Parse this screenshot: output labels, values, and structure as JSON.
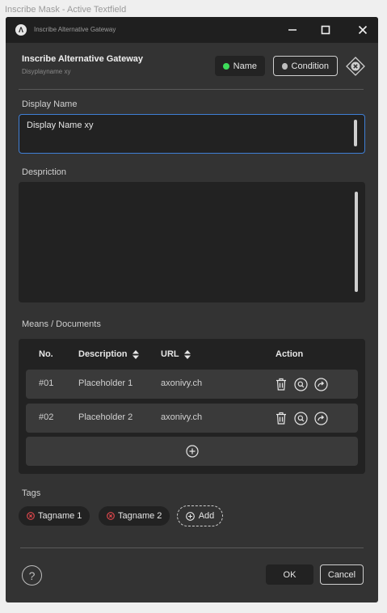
{
  "caption": "Inscribe Mask - Active Textfield",
  "window": {
    "title": "Inscribe Alternative Gateway",
    "logo_letter": "Λ"
  },
  "header": {
    "title": "Inscribe Alternative Gateway",
    "subtitle": "Disyplayname xy",
    "name_pill": "Name",
    "condition_pill": "Condition",
    "colors": {
      "name_dot": "#3ddc5a",
      "condition_dot": "#bdbdbd",
      "focus": "#3f7fd6"
    }
  },
  "display_name": {
    "label": "Display Name",
    "value": "Display Name xy"
  },
  "description": {
    "label": "Despriction",
    "value": ""
  },
  "means": {
    "label": "Means / Documents",
    "columns": {
      "no": "No.",
      "description": "Description",
      "url": "URL",
      "action": "Action"
    },
    "rows": [
      {
        "no": "#01",
        "description": "Placeholder 1",
        "url": "axonivy.ch"
      },
      {
        "no": "#02",
        "description": "Placeholder 2",
        "url": "axonivy.ch"
      }
    ]
  },
  "tags": {
    "label": "Tags",
    "items": [
      "Tagname 1",
      "Tagname 2"
    ],
    "add_label": "Add",
    "remove_color": "#e5484d"
  },
  "footer": {
    "help": "?",
    "ok": "OK",
    "cancel": "Cancel"
  }
}
